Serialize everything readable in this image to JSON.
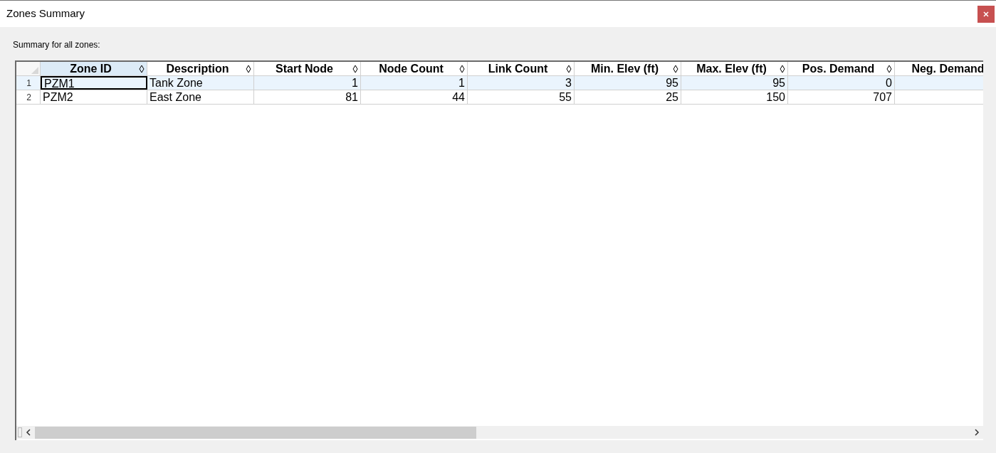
{
  "window": {
    "title": "Zones Summary"
  },
  "caption": "Summary for all zones:",
  "table": {
    "columns": [
      {
        "label": "Zone ID",
        "kind": "text",
        "selected": true,
        "sort_icon": true
      },
      {
        "label": "Description",
        "kind": "text",
        "selected": false,
        "sort_icon": true
      },
      {
        "label": "Start Node",
        "kind": "number",
        "selected": false,
        "sort_icon": true
      },
      {
        "label": "Node Count",
        "kind": "number",
        "selected": false,
        "sort_icon": true
      },
      {
        "label": "Link Count",
        "kind": "number",
        "selected": false,
        "sort_icon": true
      },
      {
        "label": "Min. Elev (ft)",
        "kind": "number",
        "selected": false,
        "sort_icon": true
      },
      {
        "label": "Max. Elev (ft)",
        "kind": "number",
        "selected": false,
        "sort_icon": true
      },
      {
        "label": "Pos. Demand",
        "kind": "number",
        "selected": false,
        "sort_icon": true
      },
      {
        "label": "Neg. Demand",
        "kind": "number",
        "selected": false,
        "sort_icon": false
      }
    ],
    "rows": [
      {
        "number": "1",
        "selected": true,
        "focused_cell": true,
        "cells": [
          "PZM1",
          "Tank Zone",
          "1",
          "1",
          "3",
          "95",
          "95",
          "0",
          ""
        ]
      },
      {
        "number": "2",
        "selected": false,
        "focused_cell": false,
        "cells": [
          "PZM2",
          "East Zone",
          "81",
          "44",
          "55",
          "25",
          "150",
          "707",
          ""
        ]
      }
    ]
  }
}
